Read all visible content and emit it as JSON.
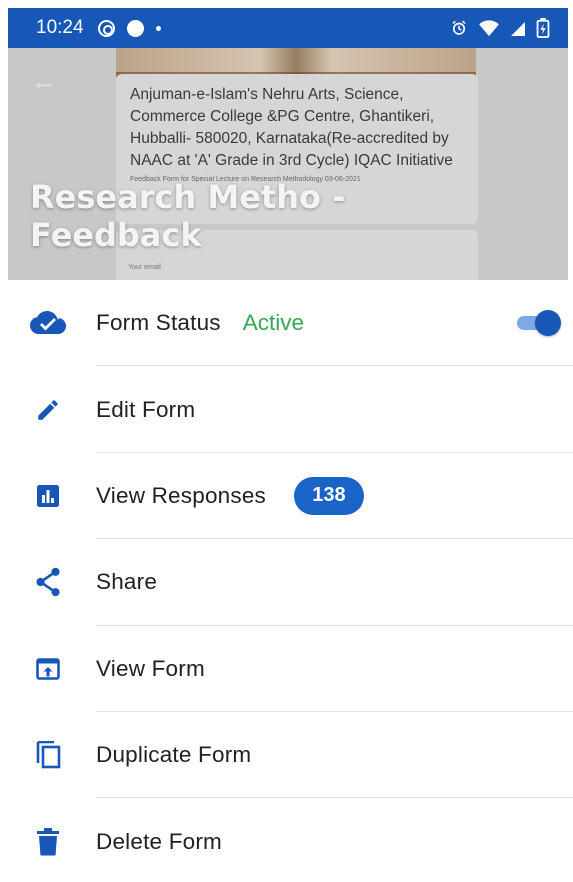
{
  "status_bar": {
    "time": "10:24",
    "background": "#1757b8"
  },
  "header": {
    "preview_title": "Anjuman-e-Islam's Nehru Arts, Science, Commerce College &PG Centre, Ghantikeri, Hubballi- 580020, Karnataka(Re-accredited by NAAC at 'A' Grade in 3rd Cycle) IQAC Initiative",
    "preview_subtitle": "Feedback Form for Special Lecture on Research Methodology 03-06-2021",
    "preview_email_label": "Your email",
    "form_title_line1": "Research Metho -",
    "form_title_line2": "Feedback"
  },
  "menu": {
    "form_status": {
      "label": "Form Status",
      "value": "Active",
      "toggle_on": true,
      "icon": "cloud-check-icon"
    },
    "edit_form": {
      "label": "Edit Form",
      "icon": "pencil-icon"
    },
    "view_responses": {
      "label": "View Responses",
      "count": "138",
      "icon": "bar-chart-icon"
    },
    "share": {
      "label": "Share",
      "icon": "share-icon"
    },
    "view_form": {
      "label": "View Form",
      "icon": "open-in-browser-icon"
    },
    "duplicate_form": {
      "label": "Duplicate Form",
      "icon": "copy-icon"
    },
    "delete_form": {
      "label": "Delete Form",
      "icon": "trash-icon"
    }
  },
  "colors": {
    "accent": "#1757b8",
    "active_green": "#34a853",
    "badge_blue": "#1a64c8"
  }
}
